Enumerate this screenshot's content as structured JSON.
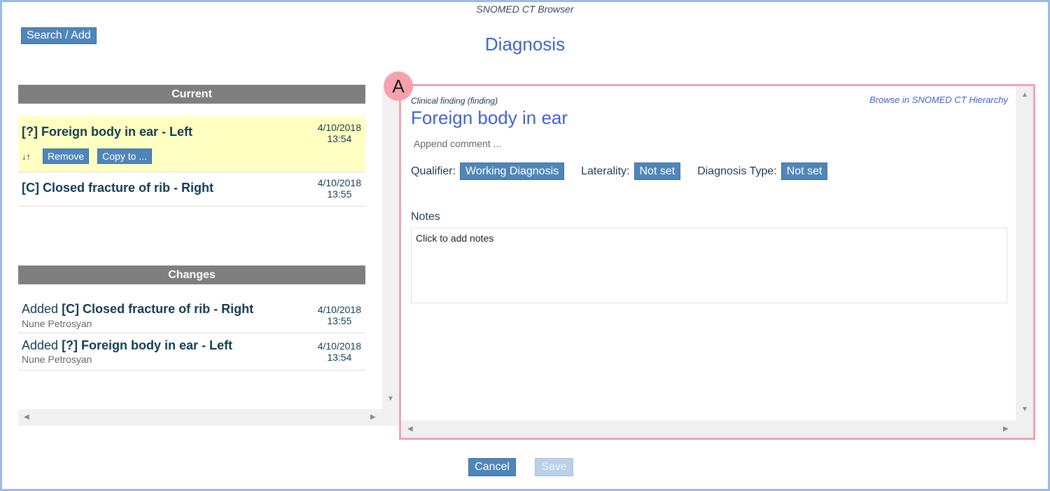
{
  "app": {
    "title": "SNOMED CT Browser"
  },
  "toolbar": {
    "search_add_label": "Search / Add"
  },
  "page": {
    "title": "Diagnosis"
  },
  "current": {
    "header": "Current",
    "items": [
      {
        "title": "[?] Foreign body in ear - Left",
        "date": "4/10/2018",
        "time": "13:54",
        "selected": true,
        "remove_label": "Remove",
        "copy_label": "Copy to ..."
      },
      {
        "title": "[C] Closed fracture of rib - Right",
        "date": "4/10/2018",
        "time": "13:55",
        "selected": false
      }
    ]
  },
  "changes": {
    "header": "Changes",
    "items": [
      {
        "prefix": "Added ",
        "title": "[C] Closed fracture of rib - Right",
        "author": "Nune Petrosyan",
        "date": "4/10/2018",
        "time": "13:55"
      },
      {
        "prefix": "Added ",
        "title": "[?] Foreign body in ear - Left",
        "author": "Nune Petrosyan",
        "date": "4/10/2018",
        "time": "13:54"
      }
    ]
  },
  "detail": {
    "badge": "A",
    "finding_type": "Clinical finding (finding)",
    "browse_link": "Browse in SNOMED CT Hierarchy",
    "concept_title": "Foreign body in ear",
    "append_comment": "Append comment ...",
    "qualifier_label": "Qualifier:",
    "qualifier_value": "Working Diagnosis",
    "laterality_label": "Laterality:",
    "laterality_value": "Not set",
    "diagnosis_type_label": "Diagnosis Type:",
    "diagnosis_type_value": "Not set",
    "notes_label": "Notes",
    "notes_placeholder": "Click to add notes"
  },
  "footer": {
    "cancel_label": "Cancel",
    "save_label": "Save"
  },
  "colors": {
    "accent": "#4f86b9",
    "title_blue": "#3f63d3",
    "highlight": "#ffffc2",
    "badge": "#f5a1ae",
    "frame": "#9dbbe6"
  },
  "icons": {
    "sort": "sort-arrows-icon",
    "scroll_up": "triangle-up",
    "scroll_down": "triangle-down",
    "scroll_left": "triangle-left",
    "scroll_right": "triangle-right"
  }
}
